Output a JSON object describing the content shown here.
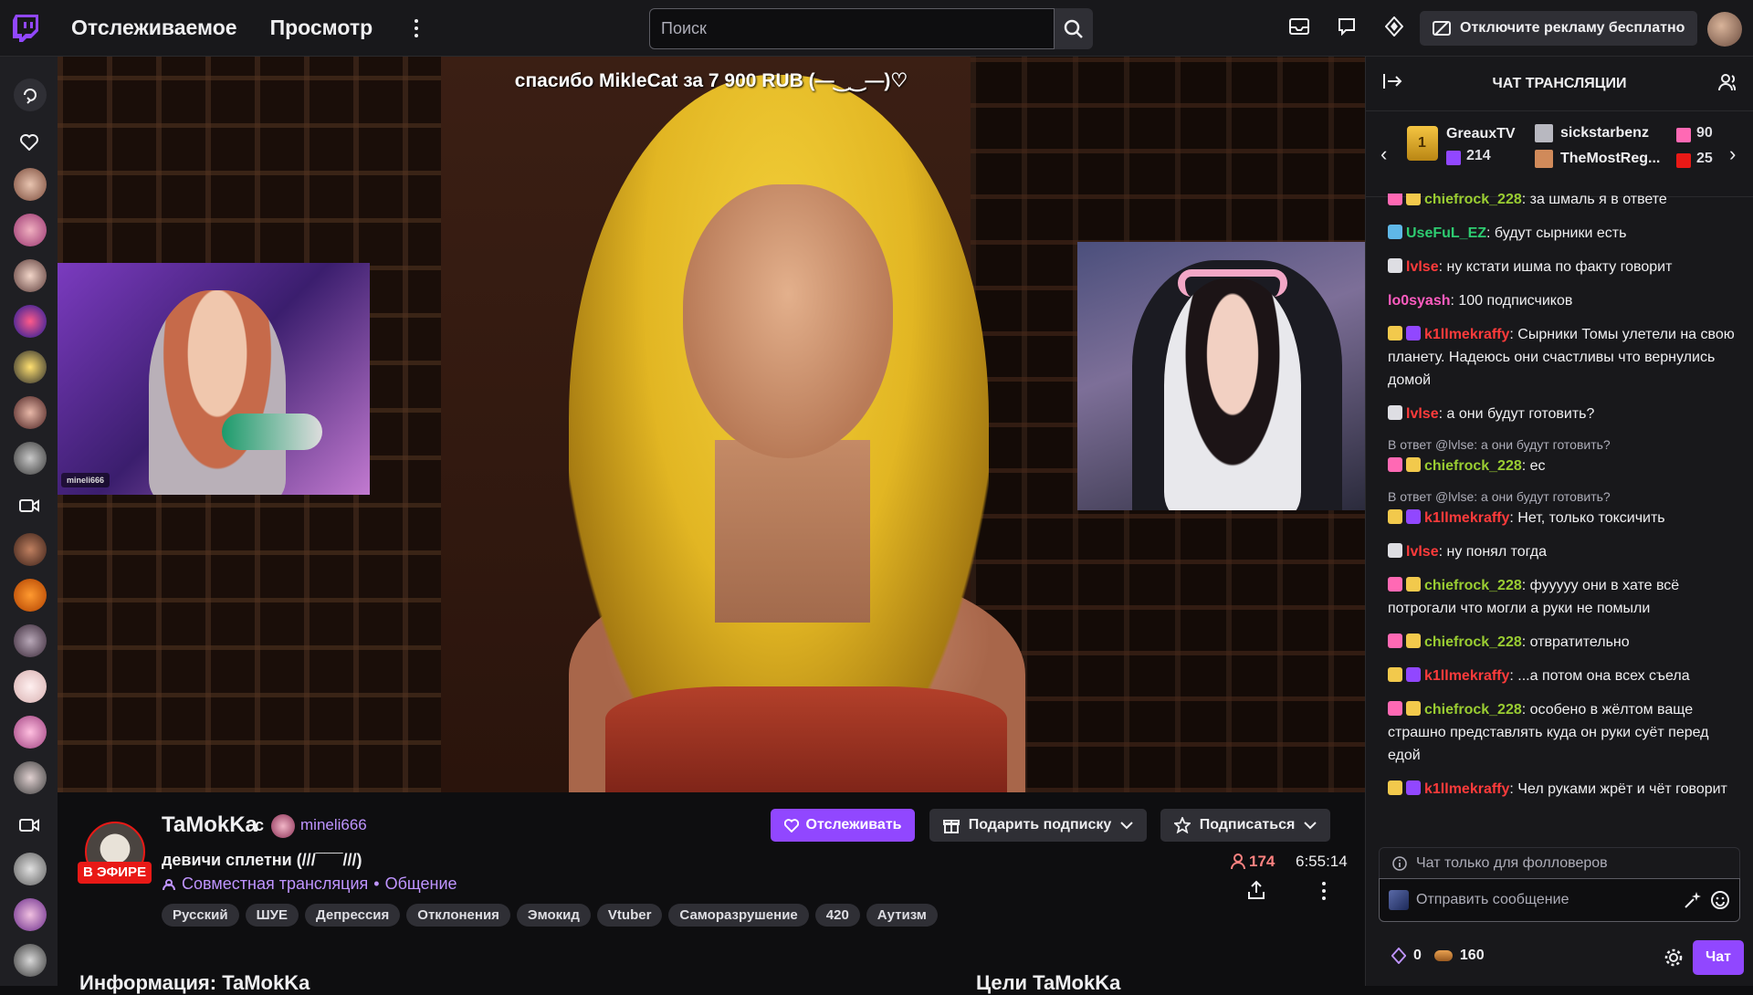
{
  "topbar": {
    "nav_following": "Отслеживаемое",
    "nav_browse": "Просмотр",
    "search_placeholder": "Поиск",
    "ad_free_label": "Отключите рекламу бесплатно"
  },
  "player": {
    "alert_text": "спасибо MikleCat за 7 900 RUB (—‿‿—)♡",
    "cam_tag": "mineli666"
  },
  "channel": {
    "streamer": "TaMokKa",
    "with": "с",
    "co_streamer": "mineli666",
    "live_label": "В ЭФИРЕ",
    "title": "девичи сплетни (///¯¯¯///)",
    "collab_label": "Совместная трансляция",
    "separator": "•",
    "category": "Общение",
    "tags": [
      "Русский",
      "ШУЕ",
      "Депрессия",
      "Отклонения",
      "Эмокид",
      "Vtuber",
      "Саморазрушение",
      "420",
      "Аутизм"
    ],
    "follow_label": "Отслеживать",
    "gift_label": "Подарить подписку",
    "subscribe_label": "Подписаться",
    "viewers": "174",
    "uptime": "6:55:14",
    "about_heading": "Информация: TaMokKa",
    "goals_heading": "Цели TaMokKa"
  },
  "chat": {
    "header": "ЧАТ ТРАНСЛЯЦИИ",
    "leaderboard": {
      "first_rank": "1",
      "first_name": "GreauxTV",
      "first_count": "214",
      "second_name": "sickstarbenz",
      "second_count": "90",
      "third_name": "TheMostReg...",
      "third_count": "25"
    },
    "messages": [
      {
        "user": "chiefrock_228",
        "text": ": за шмаль я в ответе",
        "color": "#9acd32",
        "badges": [
          "#ff69b4",
          "#f2c94c"
        ]
      },
      {
        "user": "UseFuL_EZ",
        "text": ": будут сырники есть",
        "color": "#2ecc71",
        "badges": [
          "#5fb8e8"
        ]
      },
      {
        "user": "lvlse",
        "text": ": ну кстати ишма по факту говорит",
        "color": "#ff3b3b",
        "badges": [
          "#dedee3"
        ]
      },
      {
        "user": "lo0syash",
        "text": ": 100 подписчиков",
        "color": "#ff5cc0",
        "badges": []
      },
      {
        "user": "k1llmekraffy",
        "text": ": Сырники Томы улетели на свою планету. Надеюсь они счастливы что вернулись домой",
        "color": "#ff3b3b",
        "badges": [
          "#f2c94c",
          "#9147ff"
        ]
      },
      {
        "user": "lvlse",
        "text": ": а они будут готовить?",
        "color": "#ff3b3b",
        "badges": [
          "#dedee3"
        ]
      },
      {
        "reply": "В ответ @lvlse: а они будут готовить?",
        "user": "chiefrock_228",
        "text": ": ес",
        "color": "#9acd32",
        "badges": [
          "#ff69b4",
          "#f2c94c"
        ]
      },
      {
        "reply": "В ответ @lvlse: а они будут готовить?",
        "user": "k1llmekraffy",
        "text": ": Нет, только токсичить",
        "color": "#ff3b3b",
        "badges": [
          "#f2c94c",
          "#9147ff"
        ]
      },
      {
        "user": "lvlse",
        "text": ": ну понял тогда",
        "color": "#ff3b3b",
        "badges": [
          "#dedee3"
        ]
      },
      {
        "user": "chiefrock_228",
        "text": ": фууууу они в хате всё потрогали что могли а руки не помыли",
        "color": "#9acd32",
        "badges": [
          "#ff69b4",
          "#f2c94c"
        ]
      },
      {
        "user": "chiefrock_228",
        "text": ": отвратительно",
        "color": "#9acd32",
        "badges": [
          "#ff69b4",
          "#f2c94c"
        ]
      },
      {
        "user": "k1llmekraffy",
        "text": ": ...а потом она всех съела",
        "color": "#ff3b3b",
        "badges": [
          "#f2c94c",
          "#9147ff"
        ]
      },
      {
        "user": "chiefrock_228",
        "text": ": особено в жёлтом ваще страшно представлять куда он руки суёт перед едой",
        "color": "#9acd32",
        "badges": [
          "#ff69b4",
          "#f2c94c"
        ]
      },
      {
        "user": "k1llmekraffy",
        "text": ": Чел руками жрёт и чёт говорит",
        "color": "#ff3b3b",
        "badges": [
          "#f2c94c",
          "#9147ff"
        ]
      }
    ],
    "followers_only": "Чат только для фолловеров",
    "input_placeholder": "Отправить сообщение",
    "points_a": "0",
    "points_b": "160",
    "send_label": "Чат"
  },
  "colors": {
    "accent": "#9147ff",
    "live": "#e91916",
    "background": "#0e0e10",
    "panel": "#18181b"
  },
  "icons": [
    "twitch-logo-icon",
    "search-icon",
    "inbox-icon",
    "whispers-icon",
    "prime-icon",
    "ad-icon",
    "heart-icon",
    "gift-icon",
    "star-icon",
    "share-icon",
    "gear-icon",
    "emote-icon"
  ]
}
